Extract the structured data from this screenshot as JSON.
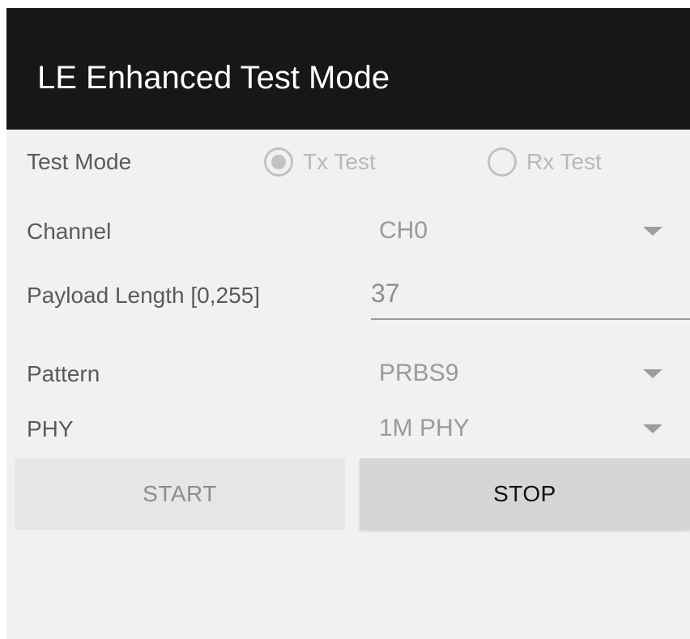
{
  "app_bar": {
    "title": "LE Enhanced Test Mode"
  },
  "form": {
    "test_mode": {
      "label": "Test Mode",
      "options": [
        {
          "label": "Tx Test",
          "checked": true
        },
        {
          "label": "Rx Test",
          "checked": false
        }
      ]
    },
    "channel": {
      "label": "Channel",
      "value": "CH0",
      "icon": "dropdown-arrow-icon"
    },
    "payload_length": {
      "label": "Payload Length [0,255]",
      "value": "37"
    },
    "pattern": {
      "label": "Pattern",
      "value": "PRBS9",
      "icon": "dropdown-arrow-icon"
    },
    "phy": {
      "label": "PHY",
      "value": "1M PHY",
      "icon": "dropdown-arrow-icon"
    }
  },
  "buttons": {
    "start_label": "START",
    "stop_label": "STOP"
  },
  "colors": {
    "app_bar": "#161719",
    "background": "#f1f1f1",
    "start_button": "#e6e6e6",
    "stop_button": "#d6d6d6"
  }
}
